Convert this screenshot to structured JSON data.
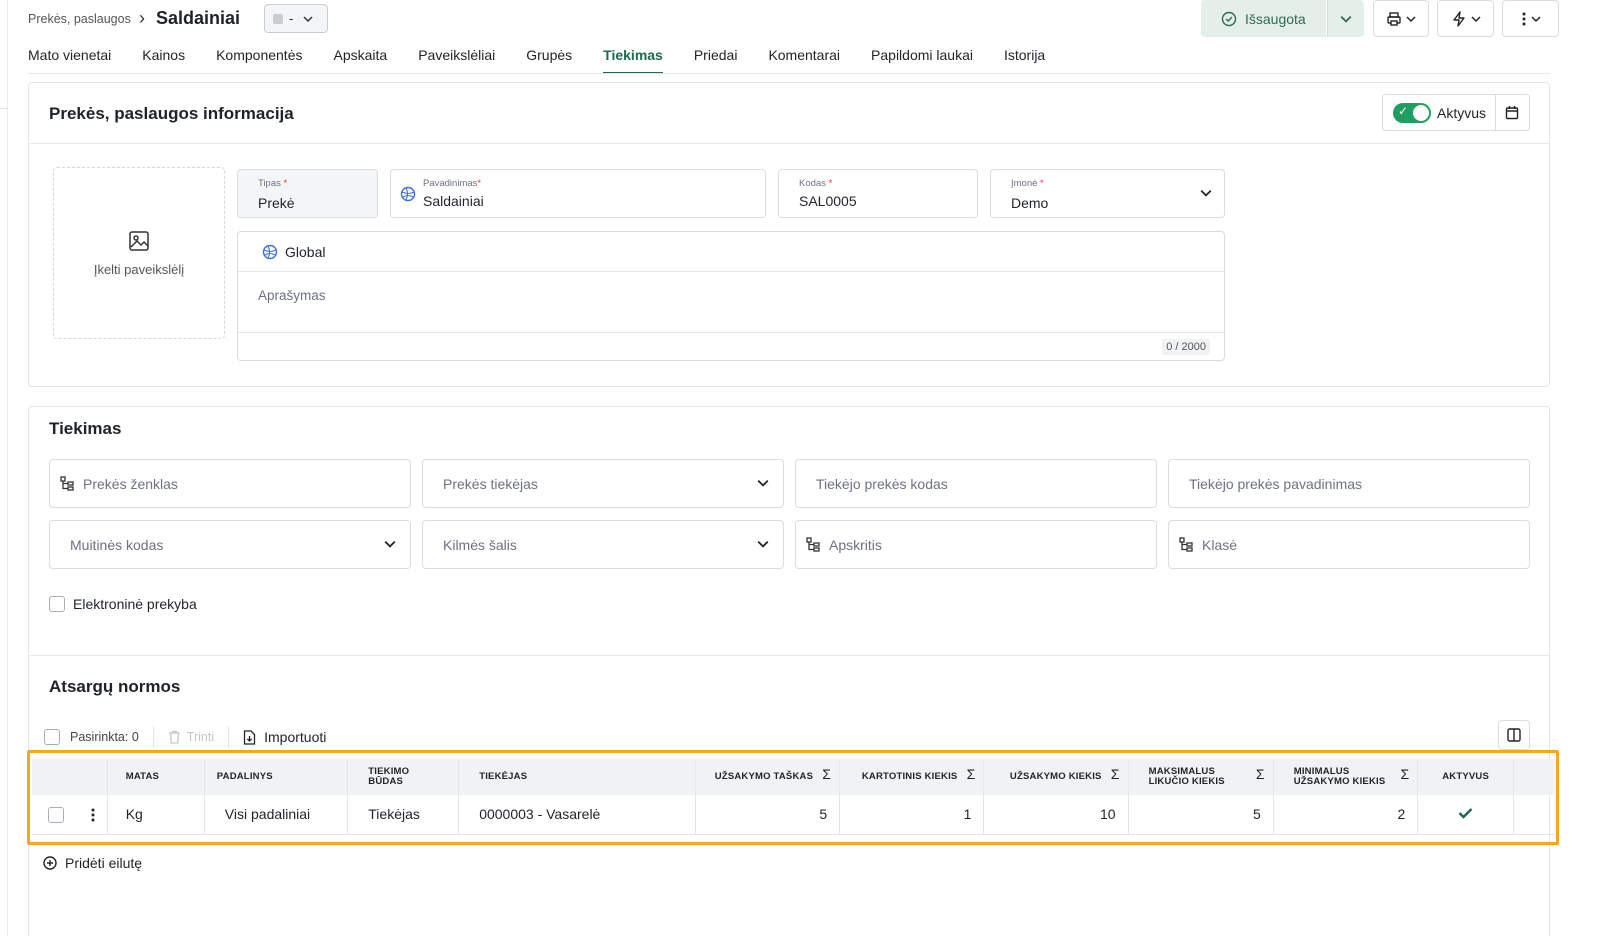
{
  "header": {
    "breadcrumb": "Prekės, paslaugos",
    "title": "Saldainiai",
    "status_value": "-",
    "saved_label": "Išsaugota"
  },
  "tabs": [
    {
      "label": "Mato vienetai"
    },
    {
      "label": "Kainos"
    },
    {
      "label": "Komponentės"
    },
    {
      "label": "Apskaita"
    },
    {
      "label": "Paveikslėliai"
    },
    {
      "label": "Grupės"
    },
    {
      "label": "Tiekimas",
      "active": true
    },
    {
      "label": "Priedai"
    },
    {
      "label": "Komentarai"
    },
    {
      "label": "Papildomi laukai"
    },
    {
      "label": "Istorija"
    }
  ],
  "info": {
    "title": "Prekės, paslaugos informacija",
    "active_label": "Aktyvus",
    "upload_label": "Įkelti paveikslėlį",
    "tipas": {
      "label": "Tipas",
      "value": "Prekė"
    },
    "pavadinimas": {
      "label": "Pavadinimas",
      "value": "Saldainiai"
    },
    "kodas": {
      "label": "Kodas",
      "value": "SAL0005"
    },
    "imone": {
      "label": "Įmonė",
      "value": "Demo"
    },
    "global_label": "Global",
    "description_placeholder": "Aprašymas",
    "char_counter": "0 / 2000"
  },
  "supply": {
    "title": "Tiekimas",
    "fields": {
      "brand": "Prekės ženklas",
      "supplier": "Prekės tiekėjas",
      "supplier_code": "Tiekėjo prekės kodas",
      "supplier_name": "Tiekėjo prekės pavadinimas",
      "customs_code": "Muitinės kodas",
      "origin_country": "Kilmės šalis",
      "district": "Apskritis",
      "class": "Klasė"
    },
    "ecommerce_label": "Elektroninė prekyba"
  },
  "stock": {
    "title": "Atsargų normos",
    "selected_label": "Pasirinkta: 0",
    "delete_label": "Trinti",
    "import_label": "Importuoti",
    "columns": {
      "matas": "Matas",
      "padalinys": "Padalinys",
      "tiekimo_budas": "Tiekimo būdas",
      "tiekejas": "Tiekėjas",
      "uzsakymo_taskas": "Užsakymo taškas",
      "kartotinis": "Kartotinis kiekis",
      "uzsakymo_kiekis": "Užsakymo kiekis",
      "maks_likucio": "Maksimalus likučio kiekis",
      "min_uzsakymo": "Minimalus užsakymo kiekis",
      "aktyvus": "Aktyvus"
    },
    "rows": [
      {
        "matas": "Kg",
        "padalinys": "Visi padaliniai",
        "tiekimo_budas": "Tiekėjas",
        "tiekejas": "0000003 - Vasarelė",
        "uzsakymo_taskas": "5",
        "kartotinis": "1",
        "uzsakymo_kiekis": "10",
        "maks_likucio": "5",
        "min_uzsakymo": "2",
        "aktyvus": true
      }
    ],
    "add_row_label": "Pridėti eilutę"
  },
  "colors": {
    "accent": "#1d6a4b",
    "toggle": "#1f9e62",
    "highlight": "#f5a623"
  },
  "icons": [
    "chevron-down-icon",
    "check-circle-icon",
    "printer-icon",
    "bolt-icon",
    "kebab-icon",
    "calendar-icon",
    "image-icon",
    "globe-icon",
    "tree-icon",
    "trash-icon",
    "import-icon",
    "columns-icon",
    "sigma-icon",
    "check-icon",
    "plus-circle-icon"
  ]
}
